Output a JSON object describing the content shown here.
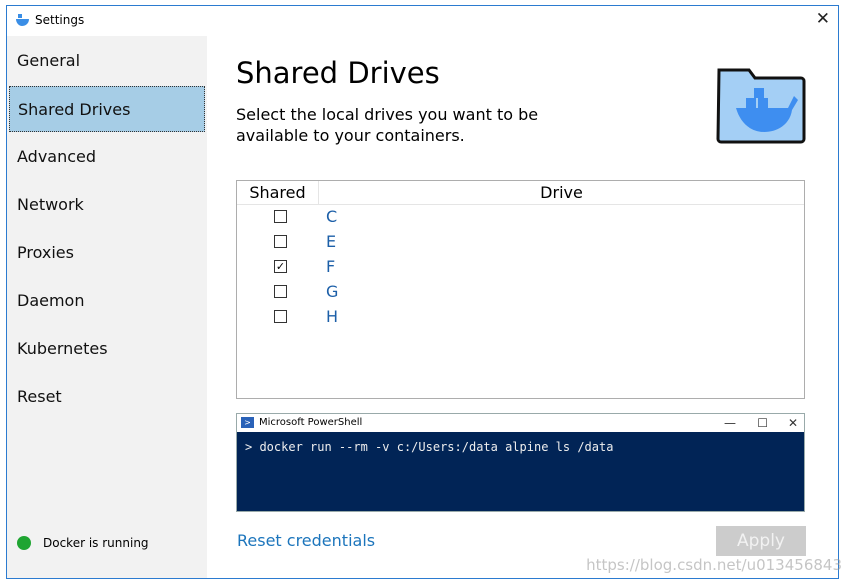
{
  "window": {
    "title": "Settings",
    "app_icon": "docker-whale-icon",
    "close_icon": "close-icon"
  },
  "sidebar": {
    "items": [
      {
        "label": "General"
      },
      {
        "label": "Shared Drives",
        "selected": true
      },
      {
        "label": "Advanced"
      },
      {
        "label": "Network"
      },
      {
        "label": "Proxies"
      },
      {
        "label": "Daemon"
      },
      {
        "label": "Kubernetes"
      },
      {
        "label": "Reset"
      }
    ],
    "status": {
      "text": "Docker is running",
      "color": "#1fa532"
    }
  },
  "main": {
    "title": "Shared Drives",
    "description": "Select the local drives you want to be available to your containers.",
    "table": {
      "headers": [
        "Shared",
        "Drive"
      ],
      "rows": [
        {
          "drive": "C",
          "shared": false
        },
        {
          "drive": "E",
          "shared": false
        },
        {
          "drive": "F",
          "shared": true
        },
        {
          "drive": "G",
          "shared": false
        },
        {
          "drive": "H",
          "shared": false
        }
      ]
    },
    "powershell": {
      "title": "Microsoft PowerShell",
      "command": "> docker run --rm -v c:/Users:/data alpine ls /data",
      "minimize": "—",
      "maximize": "☐",
      "close": "✕"
    },
    "reset_credentials": "Reset credentials",
    "apply": "Apply"
  },
  "watermark": "https://blog.csdn.net/u013456843",
  "colors": {
    "accent": "#1c75bc",
    "selected": "#a6cde6",
    "terminal": "#012456"
  }
}
